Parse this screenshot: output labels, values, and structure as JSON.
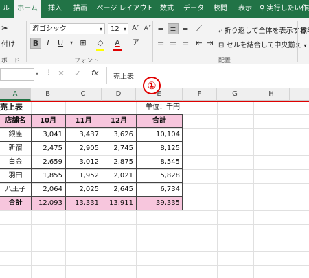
{
  "ribbon": {
    "tabs": [
      "ル",
      "ホーム",
      "挿入",
      "描画",
      "ページ レイアウト",
      "数式",
      "データ",
      "校閲",
      "表示",
      "実行したい作業"
    ],
    "font_name": "游ゴシック",
    "font_size": "12",
    "paste_label": "付け",
    "clipboard_group": "ボード",
    "font_group": "フォント",
    "alignment_group": "配置",
    "wrap_text": "折り返して全体を表示する",
    "merge_center": "セルを結合して中央揃え",
    "number_format": "標準"
  },
  "formula_bar": {
    "fx": "fx",
    "content": "売上表"
  },
  "annotation": {
    "marker": "①",
    "color": "#e00000"
  },
  "columns": [
    "A",
    "B",
    "C",
    "D",
    "E",
    "F",
    "G",
    "H"
  ],
  "sheet": {
    "title": "売上表",
    "unit": "単位：千円",
    "headers": [
      "店舗名",
      "10月",
      "11月",
      "12月",
      "合計"
    ],
    "rows": [
      [
        "銀座",
        "3,041",
        "3,437",
        "3,626",
        "10,104"
      ],
      [
        "新宿",
        "2,475",
        "2,905",
        "2,745",
        "8,125"
      ],
      [
        "白金",
        "2,659",
        "3,012",
        "2,875",
        "8,545"
      ],
      [
        "羽田",
        "1,855",
        "1,952",
        "2,021",
        "5,828"
      ],
      [
        "八王子",
        "2,064",
        "2,025",
        "2,645",
        "6,734"
      ]
    ],
    "total": [
      "合計",
      "12,093",
      "13,331",
      "13,911",
      "39,335"
    ]
  },
  "colors": {
    "excel_green": "#217346",
    "header_fill": "#f7c6dd",
    "total_fill": "#f7c6dd"
  }
}
